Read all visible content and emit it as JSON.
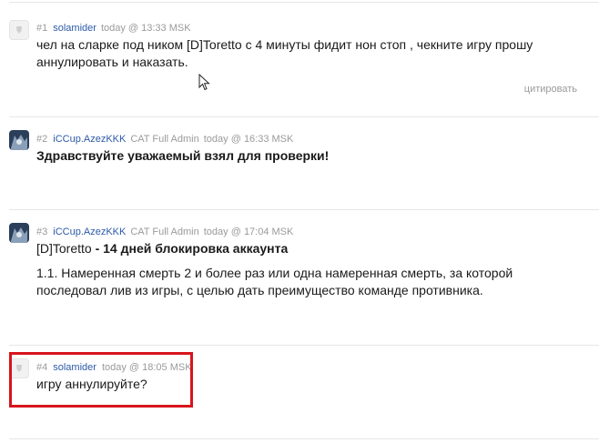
{
  "posts": [
    {
      "number": "#1",
      "user": "solamider",
      "role": "",
      "time": "today @ 13:33 MSK",
      "text": "чел на сларке под ником [D]Toretto с 4 минуты фидит нон стоп , чекните игру прошу аннулировать и наказать.",
      "quote_label": "цитировать",
      "avatar": "default-avatar-icon"
    },
    {
      "number": "#2",
      "user": "iCCup.AzezKKK",
      "role": "CAT Full Admin",
      "time": "today @ 16:33 MSK",
      "text_bold": "Здравствуйте уважаемый взял для проверки!",
      "avatar": "wolf-avatar"
    },
    {
      "number": "#3",
      "user": "iCCup.AzezKKK",
      "role": "CAT Full Admin",
      "time": "today @ 17:04 MSK",
      "text_prefix": "[D]Toretto",
      "text_bold": " - 14 дней блокировка аккаунта",
      "text_rule": "1.1. Намеренная смерть 2 и более раз или одна намеренная смерть, за которой последовал лив из игры, с целью дать преимущество команде противника.",
      "avatar": "wolf-avatar"
    },
    {
      "number": "#4",
      "user": "solamider",
      "role": "",
      "time": "today @ 18:05 MSK",
      "text": "игру аннулируйте?",
      "avatar": "default-avatar-icon"
    }
  ],
  "colors": {
    "username": "#2d5aa8",
    "meta": "#9a9a9a",
    "highlight": "#d8141c"
  }
}
